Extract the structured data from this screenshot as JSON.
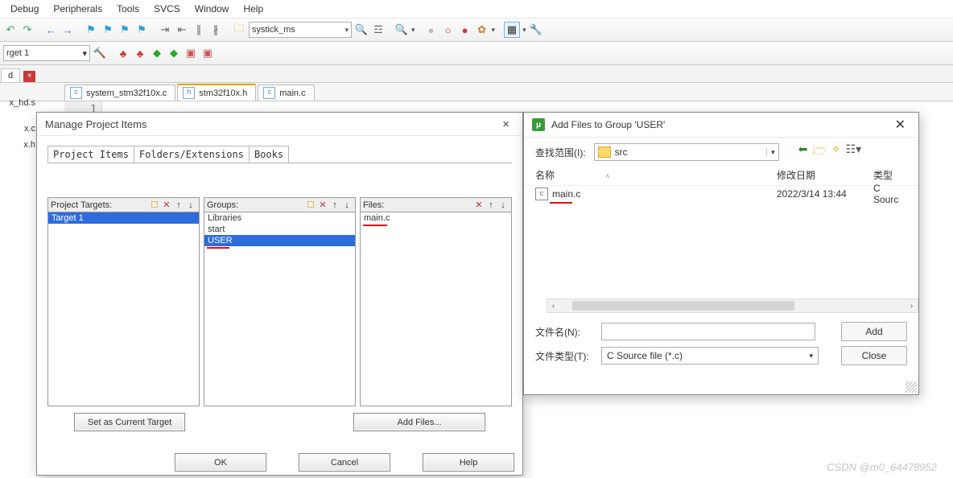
{
  "menubar": [
    "Debug",
    "Peripherals",
    "Tools",
    "SVCS",
    "Window",
    "Help"
  ],
  "toolbar": {
    "project_dropdown": "systick_ms",
    "target_dropdown": "rget 1"
  },
  "left_panel": {
    "tab": "d",
    "items": [
      "x_hd.s",
      "x.c",
      "x.h"
    ]
  },
  "file_tabs": [
    {
      "name": "system_stm32f10x.c",
      "active": false
    },
    {
      "name": "stm32f10x.h",
      "active": true
    },
    {
      "name": "main.c",
      "active": false
    }
  ],
  "editor": {
    "line_no": "1"
  },
  "mpi": {
    "title": "Manage Project Items",
    "tabs": [
      "Project Items",
      "Folders/Extensions",
      "Books"
    ],
    "col_targets": {
      "label": "Project Targets:",
      "items": [
        "Target 1"
      ]
    },
    "col_groups": {
      "label": "Groups:",
      "items": [
        "Libraries",
        "start",
        "USER"
      ]
    },
    "col_files": {
      "label": "Files:",
      "items": [
        "main.c"
      ]
    },
    "btn_set": "Set as Current Target",
    "btn_add": "Add Files...",
    "ok": "OK",
    "cancel": "Cancel",
    "help": "Help"
  },
  "afd": {
    "title": "Add Files to Group 'USER'",
    "lookin_label": "查找范围(I):",
    "lookin_value": "src",
    "cols": {
      "name": "名称",
      "date": "修改日期",
      "type": "类型"
    },
    "rows": [
      {
        "name": "main.c",
        "date": "2022/3/14 13:44",
        "type": "C Sourc"
      }
    ],
    "filename_label": "文件名(N):",
    "filename_value": "",
    "filetype_label": "文件类型(T):",
    "filetype_value": "C Source file (*.c)",
    "add": "Add",
    "close": "Close"
  },
  "watermark": "CSDN @m0_64478952"
}
